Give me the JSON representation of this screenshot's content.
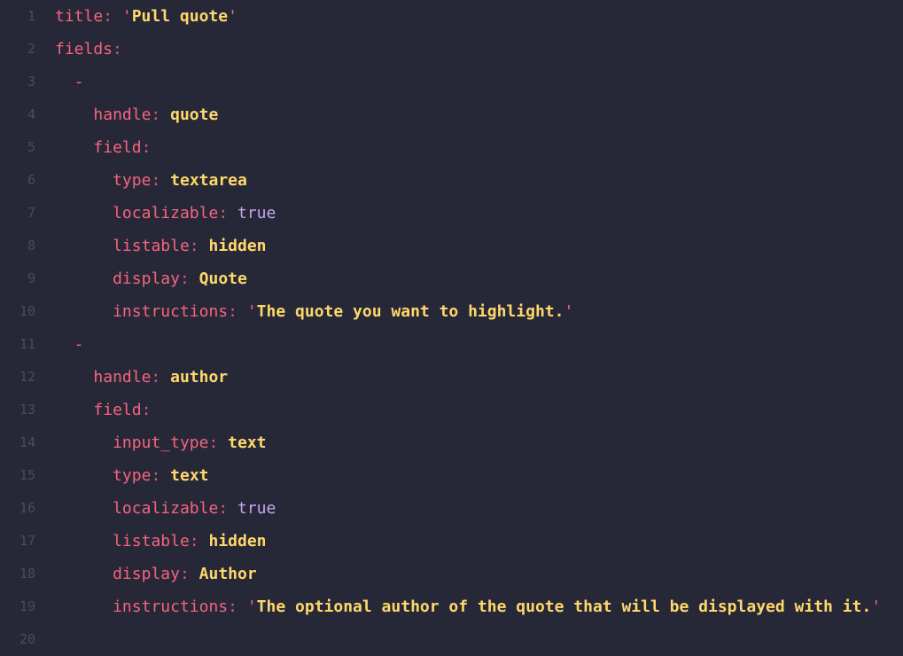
{
  "lines": [
    {
      "num": "1",
      "indent": "",
      "tokens": [
        {
          "t": "key",
          "v": "title"
        },
        {
          "t": "punct",
          "v": ": "
        },
        {
          "t": "quote",
          "v": "'"
        },
        {
          "t": "str",
          "v": "Pull quote"
        },
        {
          "t": "quote",
          "v": "'"
        }
      ]
    },
    {
      "num": "2",
      "indent": "",
      "tokens": [
        {
          "t": "key",
          "v": "fields"
        },
        {
          "t": "punct",
          "v": ":"
        }
      ]
    },
    {
      "num": "3",
      "indent": "  ",
      "tokens": [
        {
          "t": "dash",
          "v": "-"
        }
      ]
    },
    {
      "num": "4",
      "indent": "    ",
      "tokens": [
        {
          "t": "key",
          "v": "handle"
        },
        {
          "t": "punct",
          "v": ": "
        },
        {
          "t": "str",
          "v": "quote"
        }
      ]
    },
    {
      "num": "5",
      "indent": "    ",
      "tokens": [
        {
          "t": "key",
          "v": "field"
        },
        {
          "t": "punct",
          "v": ":"
        }
      ]
    },
    {
      "num": "6",
      "indent": "      ",
      "tokens": [
        {
          "t": "key",
          "v": "type"
        },
        {
          "t": "punct",
          "v": ": "
        },
        {
          "t": "str",
          "v": "textarea"
        }
      ]
    },
    {
      "num": "7",
      "indent": "      ",
      "tokens": [
        {
          "t": "key",
          "v": "localizable"
        },
        {
          "t": "punct",
          "v": ": "
        },
        {
          "t": "bool",
          "v": "true"
        }
      ]
    },
    {
      "num": "8",
      "indent": "      ",
      "tokens": [
        {
          "t": "key",
          "v": "listable"
        },
        {
          "t": "punct",
          "v": ": "
        },
        {
          "t": "str",
          "v": "hidden"
        }
      ]
    },
    {
      "num": "9",
      "indent": "      ",
      "tokens": [
        {
          "t": "key",
          "v": "display"
        },
        {
          "t": "punct",
          "v": ": "
        },
        {
          "t": "str",
          "v": "Quote"
        }
      ]
    },
    {
      "num": "10",
      "indent": "      ",
      "tokens": [
        {
          "t": "key",
          "v": "instructions"
        },
        {
          "t": "punct",
          "v": ": "
        },
        {
          "t": "quote",
          "v": "'"
        },
        {
          "t": "str",
          "v": "The quote you want to highlight."
        },
        {
          "t": "quote",
          "v": "'"
        }
      ]
    },
    {
      "num": "11",
      "indent": "  ",
      "tokens": [
        {
          "t": "dash",
          "v": "-"
        }
      ]
    },
    {
      "num": "12",
      "indent": "    ",
      "tokens": [
        {
          "t": "key",
          "v": "handle"
        },
        {
          "t": "punct",
          "v": ": "
        },
        {
          "t": "str",
          "v": "author"
        }
      ]
    },
    {
      "num": "13",
      "indent": "    ",
      "tokens": [
        {
          "t": "key",
          "v": "field"
        },
        {
          "t": "punct",
          "v": ":"
        }
      ]
    },
    {
      "num": "14",
      "indent": "      ",
      "tokens": [
        {
          "t": "key",
          "v": "input_type"
        },
        {
          "t": "punct",
          "v": ": "
        },
        {
          "t": "str",
          "v": "text"
        }
      ]
    },
    {
      "num": "15",
      "indent": "      ",
      "tokens": [
        {
          "t": "key",
          "v": "type"
        },
        {
          "t": "punct",
          "v": ": "
        },
        {
          "t": "str",
          "v": "text"
        }
      ]
    },
    {
      "num": "16",
      "indent": "      ",
      "tokens": [
        {
          "t": "key",
          "v": "localizable"
        },
        {
          "t": "punct",
          "v": ": "
        },
        {
          "t": "bool",
          "v": "true"
        }
      ]
    },
    {
      "num": "17",
      "indent": "      ",
      "tokens": [
        {
          "t": "key",
          "v": "listable"
        },
        {
          "t": "punct",
          "v": ": "
        },
        {
          "t": "str",
          "v": "hidden"
        }
      ]
    },
    {
      "num": "18",
      "indent": "      ",
      "tokens": [
        {
          "t": "key",
          "v": "display"
        },
        {
          "t": "punct",
          "v": ": "
        },
        {
          "t": "str",
          "v": "Author"
        }
      ]
    },
    {
      "num": "19",
      "indent": "      ",
      "tokens": [
        {
          "t": "key",
          "v": "instructions"
        },
        {
          "t": "punct",
          "v": ": "
        },
        {
          "t": "quote",
          "v": "'"
        },
        {
          "t": "str",
          "v": "The optional author of the quote that will be displayed with it."
        },
        {
          "t": "quote",
          "v": "'"
        }
      ]
    },
    {
      "num": "20",
      "indent": "",
      "tokens": []
    }
  ],
  "colors": {
    "background": "#262837",
    "line_number": "#4a4c5c",
    "key": "#f7647e",
    "string": "#ffd86b",
    "boolean": "#c6a6ee"
  }
}
